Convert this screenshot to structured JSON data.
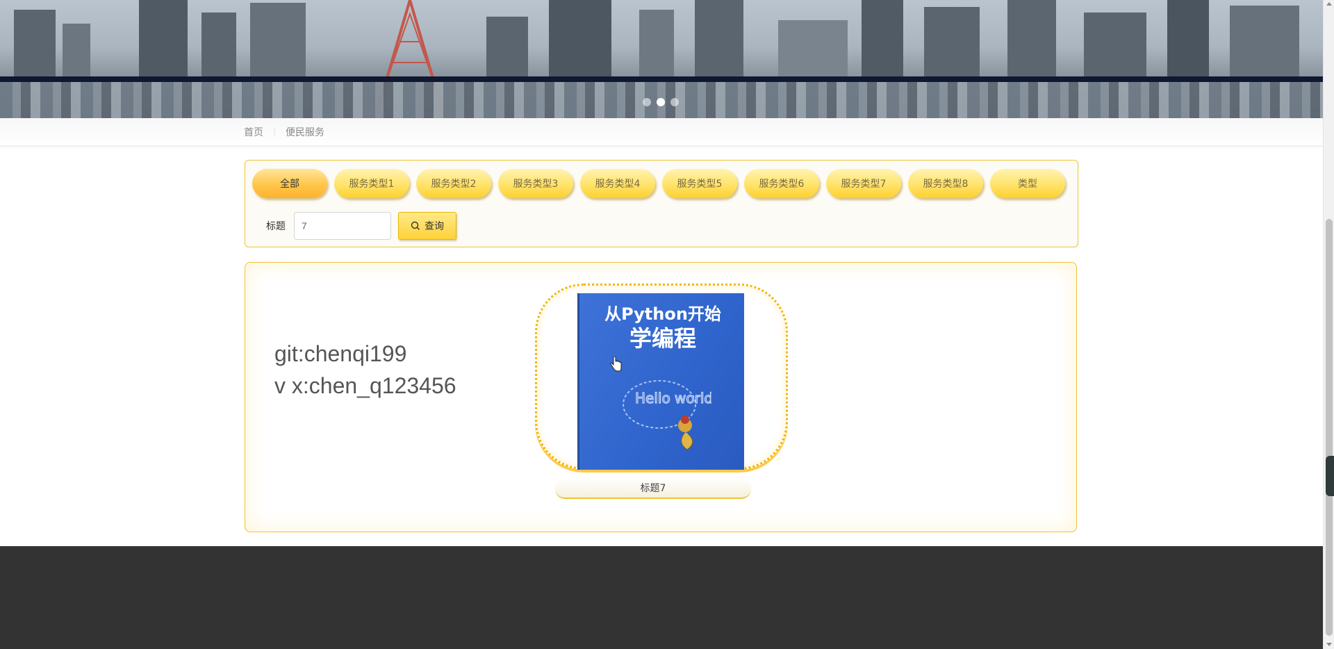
{
  "breadcrumb": {
    "home": "首页",
    "current": "便民服务"
  },
  "banner": {
    "slides": 3,
    "active_slide": 2
  },
  "filter": {
    "types": [
      "全部",
      "服务类型1",
      "服务类型2",
      "服务类型3",
      "服务类型4",
      "服务类型5",
      "服务类型6",
      "服务类型7",
      "服务类型8",
      "类型"
    ],
    "active_index": 0,
    "search_label": "标题",
    "search_value": "7",
    "search_button": "查询"
  },
  "content": {
    "contact_line1": "git:chenqi199",
    "contact_line2": "v x:chen_q123456",
    "items": [
      {
        "title": "标题7",
        "cover_title_line1": "从Python开始",
        "cover_title_line2": "学编程",
        "cover_doodle": "Hello world"
      }
    ]
  }
}
